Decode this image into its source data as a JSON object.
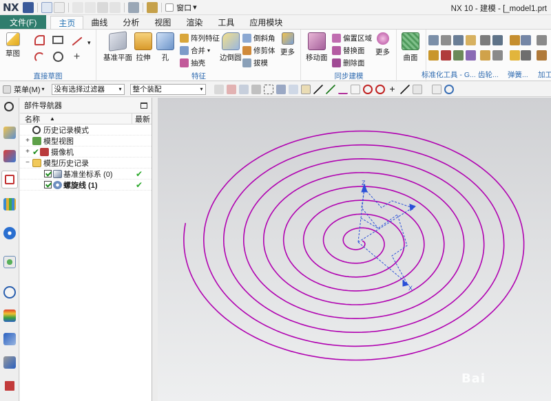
{
  "titlebar": {
    "logo": "NX",
    "window_menu": "窗口",
    "title": "NX 10 - 建模 - [_model1.prt"
  },
  "tabs": {
    "file": "文件(F)",
    "items": [
      "主页",
      "曲线",
      "分析",
      "视图",
      "渲染",
      "工具",
      "应用模块"
    ],
    "active": "主页"
  },
  "ribbon": {
    "sketch_group": {
      "label": "直接草图",
      "sketch": "草图"
    },
    "feature_group": {
      "label": "特征",
      "datum_plane": "基准平面",
      "extrude": "拉伸",
      "hole": "孔",
      "pattern_feature": "阵列特征",
      "unite": "合并",
      "shell": "抽壳",
      "edge_blend": "边倒圆",
      "chamfer": "倒斜角",
      "trim_body": "修剪体",
      "draft": "拔模",
      "more": "更多"
    },
    "sync_group": {
      "label": "同步建模",
      "move_face": "移动面",
      "offset_region": "偏置区域",
      "replace_face": "替换面",
      "delete_face": "删除面",
      "more": "更多"
    },
    "surface_group": {
      "surface": "曲面"
    },
    "std_tools": "标准化工具 - G...",
    "gear": "齿轮...",
    "spring": "弹簧...",
    "machining": "加工"
  },
  "selbar": {
    "menu": "菜单(M)",
    "filter": "没有选择过滤器",
    "assembly": "整个装配"
  },
  "navigator": {
    "title": "部件导航器",
    "col_name": "名称",
    "col_new": "最新",
    "rows": [
      {
        "label": "历史记录模式"
      },
      {
        "label": "模型视图"
      },
      {
        "label": "摄像机"
      },
      {
        "label": "模型历史记录"
      },
      {
        "label": "基准坐标系 (0)"
      },
      {
        "label": "螺旋线 (1)"
      }
    ]
  },
  "viewport": {
    "axis_x": "X",
    "axis_y": "Y",
    "axis_z": "Z",
    "watermark": "Bai"
  },
  "colors": {
    "file_tab": "#2f7d6d",
    "active_tab_text": "#1f6fb2",
    "group_label": "#2f6bb0",
    "spiral": "#b000b0",
    "csys": "#2a4fd8",
    "check_green": "#29a829"
  }
}
